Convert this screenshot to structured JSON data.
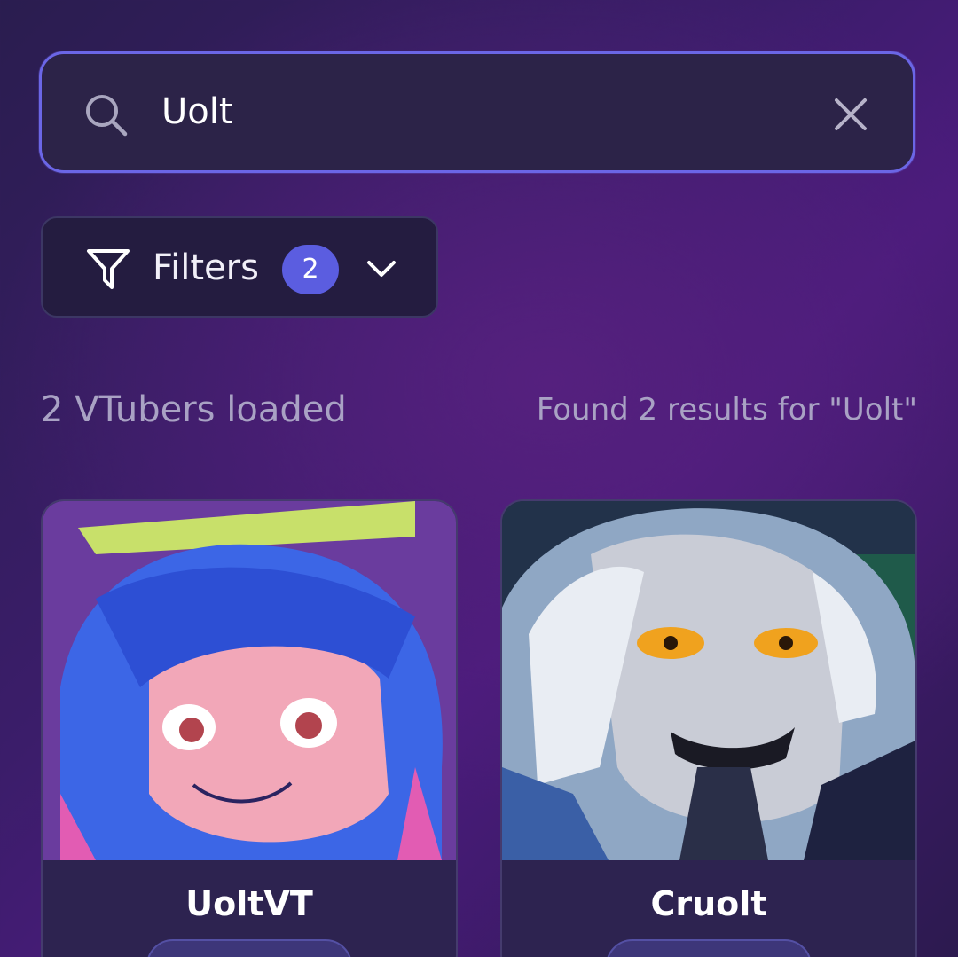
{
  "search": {
    "value": "Uolt",
    "icon": "search-icon",
    "clear_icon": "close-icon"
  },
  "filters": {
    "label": "Filters",
    "active_count": "2",
    "icon": "filter-icon",
    "chevron_icon": "chevron-down-icon"
  },
  "status": {
    "loaded": "2 VTubers loaded",
    "results": "Found 2 results for \"Uolt\""
  },
  "results": [
    {
      "name": "UoltVT"
    },
    {
      "name": "Cruolt"
    }
  ],
  "colors": {
    "accent": "#5b5de0",
    "search_border": "#6b66e6",
    "muted_text": "#a9a2c4"
  }
}
